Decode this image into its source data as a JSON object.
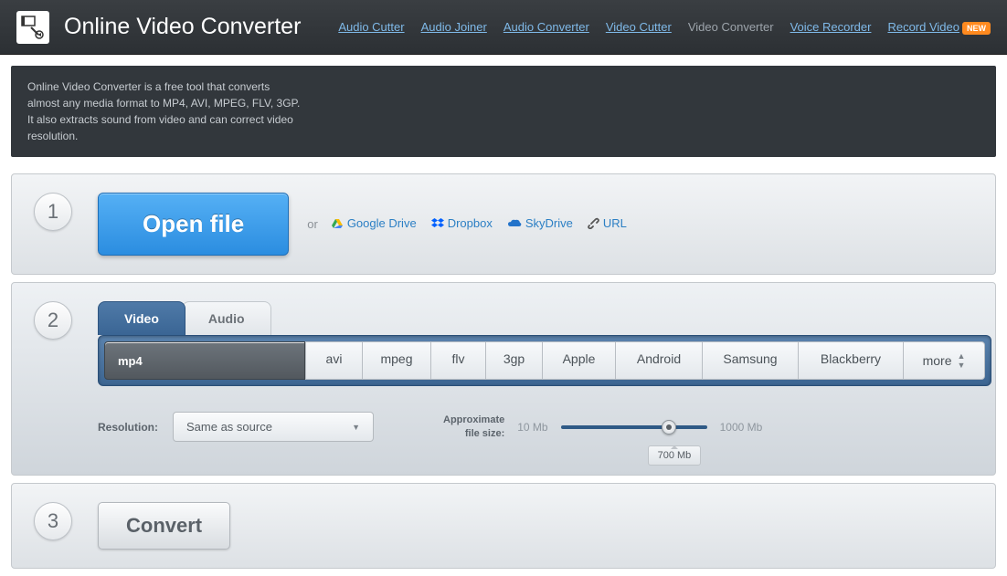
{
  "header": {
    "title": "Online Video Converter",
    "nav": [
      {
        "label": "Audio Cutter",
        "current": false
      },
      {
        "label": "Audio Joiner",
        "current": false
      },
      {
        "label": "Audio Converter",
        "current": false
      },
      {
        "label": "Video Cutter",
        "current": false
      },
      {
        "label": "Video Converter",
        "current": true
      },
      {
        "label": "Voice Recorder",
        "current": false
      },
      {
        "label": "Record Video",
        "current": false,
        "badge": "NEW"
      }
    ]
  },
  "description": "Online Video Converter is a free tool that converts almost any media format to MP4, AVI, MPEG, FLV, 3GP. It also extracts sound from video and can correct video resolution.",
  "step1": {
    "num": "1",
    "open_label": "Open file",
    "or": "or",
    "sources": [
      {
        "label": "Google Drive",
        "icon": "gdrive"
      },
      {
        "label": "Dropbox",
        "icon": "dropbox"
      },
      {
        "label": "SkyDrive",
        "icon": "skydrive"
      },
      {
        "label": "URL",
        "icon": "url"
      }
    ]
  },
  "step2": {
    "num": "2",
    "tabs": [
      {
        "label": "Video",
        "active": true
      },
      {
        "label": "Audio",
        "active": false
      }
    ],
    "formats": [
      "mp4",
      "avi",
      "mpeg",
      "flv",
      "3gp",
      "Apple",
      "Android",
      "Samsung",
      "Blackberry",
      "more"
    ],
    "selected_format": "mp4",
    "resolution_label": "Resolution:",
    "resolution_value": "Same as source",
    "filesize_label_l1": "Approximate",
    "filesize_label_l2": "file size:",
    "size_min": "10 Mb",
    "size_max": "1000 Mb",
    "size_val": "700 Mb"
  },
  "step3": {
    "num": "3",
    "convert_label": "Convert"
  }
}
